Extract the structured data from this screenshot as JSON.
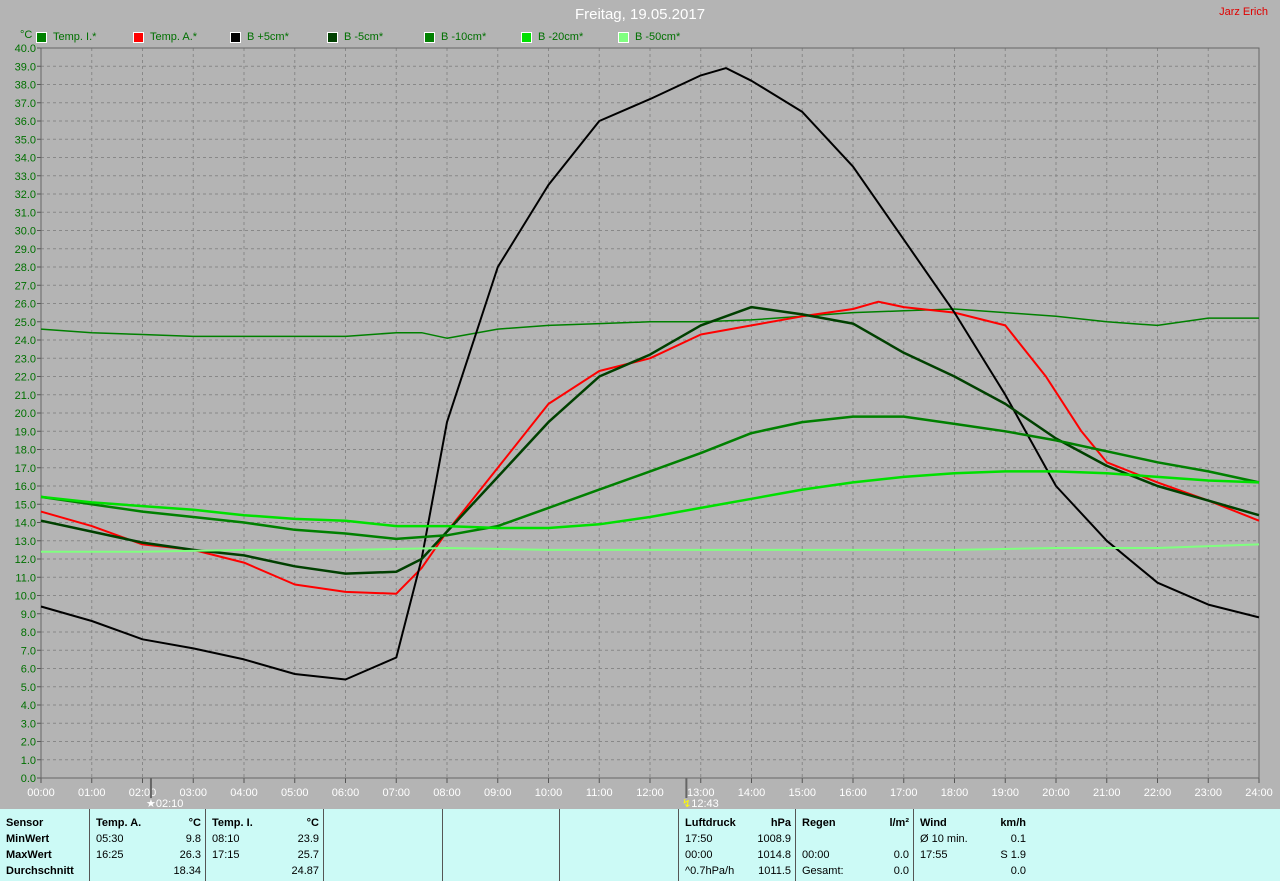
{
  "title": "Freitag, 19.05.2017",
  "author": "Jarz Erich",
  "markers": [
    {
      "time": "02:10",
      "hour": 2.1667
    },
    {
      "time": "12:43",
      "hour": 12.7167
    }
  ],
  "chart_data": {
    "type": "line",
    "title": "Freitag, 19.05.2017",
    "ylabel": "°C",
    "ylim": [
      0,
      40
    ],
    "xlim": [
      0,
      24
    ],
    "grid": true,
    "x_ticks": [
      "00:00",
      "01:00",
      "02:00",
      "03:00",
      "04:00",
      "05:00",
      "06:00",
      "07:00",
      "08:00",
      "09:00",
      "10:00",
      "11:00",
      "12:00",
      "13:00",
      "14:00",
      "15:00",
      "16:00",
      "17:00",
      "18:00",
      "19:00",
      "20:00",
      "21:00",
      "22:00",
      "23:00",
      "24:00"
    ],
    "series": [
      {
        "name": "Temp. I.*",
        "color": "#008000",
        "width": 1.5,
        "x": [
          0,
          1,
          2,
          3,
          4,
          5,
          6,
          7,
          7.5,
          8,
          9,
          10,
          11,
          12,
          13,
          14,
          15,
          16,
          17,
          18,
          19,
          20,
          21,
          22,
          23,
          24
        ],
        "y": [
          24.6,
          24.4,
          24.3,
          24.2,
          24.2,
          24.2,
          24.2,
          24.4,
          24.4,
          24.1,
          24.6,
          24.8,
          24.9,
          25,
          25,
          25.1,
          25.3,
          25.5,
          25.6,
          25.7,
          25.5,
          25.3,
          25,
          24.8,
          25.2,
          25.2
        ]
      },
      {
        "name": "Temp. A.*",
        "color": "#ff0000",
        "width": 2,
        "x": [
          0,
          1,
          2,
          3,
          4,
          5,
          6,
          7,
          7.5,
          8,
          9,
          10,
          11,
          12,
          13,
          14,
          15,
          16,
          16.5,
          17,
          18,
          19,
          19.8,
          20.5,
          21,
          22,
          23,
          24
        ],
        "y": [
          14.6,
          13.8,
          12.8,
          12.5,
          11.8,
          10.6,
          10.2,
          10.1,
          11.5,
          13.5,
          17,
          20.5,
          22.3,
          23,
          24.3,
          24.8,
          25.3,
          25.7,
          26.1,
          25.8,
          25.5,
          24.8,
          22,
          19,
          17.3,
          16.2,
          15.2,
          14.1
        ]
      },
      {
        "name": "B +5cm*",
        "color": "#000000",
        "width": 2,
        "x": [
          0,
          1,
          2,
          3,
          4,
          5,
          6,
          7,
          7.5,
          8,
          9,
          10,
          11,
          12,
          13,
          13.5,
          14,
          15,
          16,
          17,
          18,
          19,
          20,
          21,
          22,
          23,
          24
        ],
        "y": [
          9.4,
          8.6,
          7.6,
          7.1,
          6.5,
          5.7,
          5.4,
          6.6,
          12,
          19.5,
          28,
          32.5,
          36,
          37.2,
          38.5,
          38.9,
          38.2,
          36.5,
          33.5,
          29.5,
          25.5,
          21,
          16,
          13,
          10.7,
          9.5,
          8.8
        ]
      },
      {
        "name": "B -5cm*",
        "color": "#004000",
        "width": 2.5,
        "x": [
          0,
          1,
          2,
          3,
          4,
          5,
          6,
          7,
          7.5,
          8,
          9,
          10,
          11,
          12,
          13,
          14,
          15,
          16,
          17,
          18,
          19,
          20,
          21,
          22,
          23,
          24
        ],
        "y": [
          14.1,
          13.5,
          12.9,
          12.5,
          12.2,
          11.6,
          11.2,
          11.3,
          12,
          13.5,
          16.5,
          19.5,
          22,
          23.2,
          24.8,
          25.8,
          25.4,
          24.9,
          23.3,
          22,
          20.5,
          18.6,
          17.1,
          16,
          15.2,
          14.4
        ]
      },
      {
        "name": "B -10cm*",
        "color": "#008000",
        "width": 2.5,
        "x": [
          0,
          1,
          2,
          3,
          4,
          5,
          6,
          7,
          8,
          9,
          10,
          11,
          12,
          13,
          14,
          15,
          16,
          17,
          18,
          19,
          20,
          21,
          22,
          23,
          24
        ],
        "y": [
          15.4,
          15,
          14.6,
          14.3,
          14,
          13.6,
          13.4,
          13.1,
          13.3,
          13.8,
          14.8,
          15.8,
          16.8,
          17.8,
          18.9,
          19.5,
          19.8,
          19.8,
          19.4,
          19,
          18.5,
          17.9,
          17.3,
          16.8,
          16.2
        ]
      },
      {
        "name": "B -20cm*",
        "color": "#00e000",
        "width": 2.5,
        "x": [
          0,
          1,
          2,
          3,
          4,
          5,
          6,
          7,
          8,
          9,
          10,
          11,
          12,
          13,
          14,
          15,
          16,
          17,
          18,
          19,
          20,
          21,
          22,
          23,
          24
        ],
        "y": [
          15.4,
          15.1,
          14.9,
          14.7,
          14.4,
          14.2,
          14.1,
          13.8,
          13.8,
          13.7,
          13.7,
          13.9,
          14.3,
          14.8,
          15.3,
          15.8,
          16.2,
          16.5,
          16.7,
          16.8,
          16.8,
          16.7,
          16.5,
          16.3,
          16.2
        ]
      },
      {
        "name": "B -50cm*",
        "color": "#80ff80",
        "width": 2,
        "x": [
          0,
          2,
          4,
          6,
          8,
          10,
          12,
          14,
          16,
          18,
          20,
          22,
          24
        ],
        "y": [
          12.4,
          12.4,
          12.5,
          12.5,
          12.6,
          12.5,
          12.5,
          12.5,
          12.5,
          12.5,
          12.6,
          12.6,
          12.8
        ]
      }
    ]
  },
  "table": {
    "labels": [
      "Sensor",
      "MinWert",
      "MaxWert",
      "Durchschnitt"
    ],
    "temp_a": {
      "header": "Temp. A.",
      "unit": "°C",
      "min_time": "05:30",
      "min": "9.8",
      "max_time": "16:25",
      "max": "26.3",
      "avg": "18.34"
    },
    "temp_i": {
      "header": "Temp. I.",
      "unit": "°C",
      "min_time": "08:10",
      "min": "23.9",
      "max_time": "17:15",
      "max": "25.7",
      "avg": "24.87"
    },
    "pressure": {
      "header": "Luftdruck",
      "unit": "hPa",
      "min_time": "17:50",
      "min": "1008.9",
      "max_time": "00:00",
      "max": "1014.8",
      "trend": "^0.7hPa/h",
      "current": "1011.5"
    },
    "rain": {
      "header": "Regen",
      "unit": "l/m²",
      "time": "00:00",
      "value": "0.0",
      "total_label": "Gesamt:",
      "total": "0.0"
    },
    "wind": {
      "header": "Wind",
      "unit": "km/h",
      "avg_label": "Ø 10 min.",
      "avg": "0.1",
      "gust_time": "17:55",
      "gust": "S 1.9",
      "last": "0.0"
    }
  }
}
